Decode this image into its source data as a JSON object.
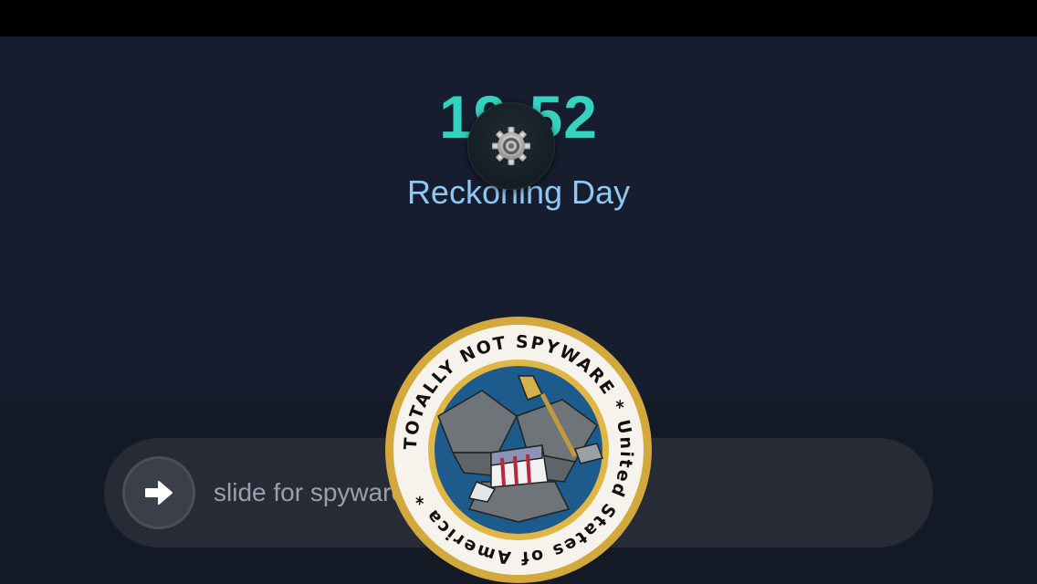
{
  "lock_screen": {
    "time": "19:52",
    "date": "Reckoning Day"
  },
  "slider": {
    "label": "slide for spyware"
  },
  "icons": {
    "settings": "gear-icon",
    "slider_knob": "arrow-right-icon",
    "seal": "eagle-seal-icon"
  },
  "seal": {
    "outer_text": "TOTALLY NOT SPYWARE * United States of America *"
  },
  "colors": {
    "clock": "#34d3bf",
    "date": "#8fc8f3",
    "slider_label": "#9aa0ab",
    "status_bar": "#000000"
  }
}
